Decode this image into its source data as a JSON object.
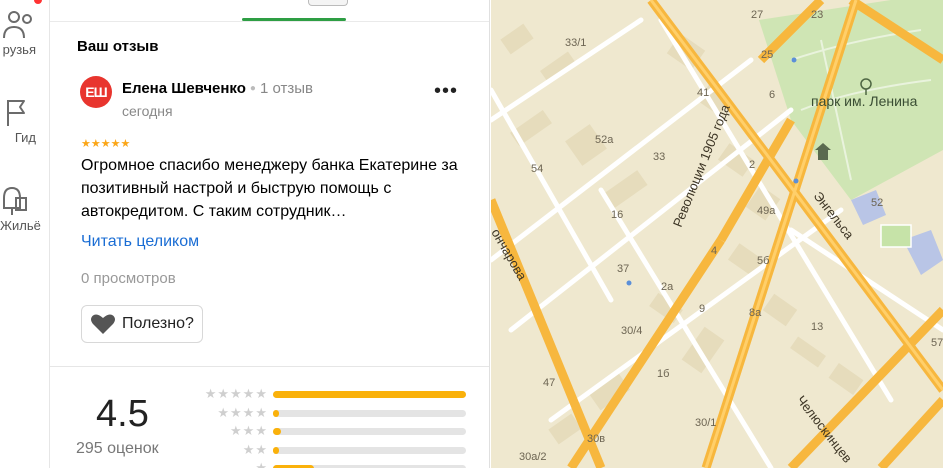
{
  "rail": {
    "items": [
      {
        "label": "рузья",
        "icon": "friends-icon"
      },
      {
        "label": "Гид",
        "icon": "flag-icon"
      },
      {
        "label": "Жильё",
        "icon": "housing-icon"
      }
    ]
  },
  "review": {
    "section_title": "Ваш отзыв",
    "avatar_initials": "ЕШ",
    "author_name": "Елена Шевченко",
    "author_review_count": "1 отзыв",
    "date": "сегодня",
    "stars": 5,
    "text": "Огромное спасибо менеджеру банка Екатерине за позитивный настрой и быструю помощь с автокредитом. С таким сотрудник…",
    "read_more": "Читать целиком",
    "views": "0 просмотров",
    "useful_label": "Полезно?"
  },
  "rating": {
    "average": "4.5",
    "count_label": "295 оценок",
    "distribution": [
      {
        "stars": 5,
        "share": 1.0
      },
      {
        "stars": 4,
        "share": 0.03
      },
      {
        "stars": 3,
        "share": 0.04
      },
      {
        "stars": 2,
        "share": 0.03
      },
      {
        "stars": 1,
        "share": 0.21
      }
    ]
  },
  "colors": {
    "accent_green": "#2e9e44",
    "star_yellow": "#fba617",
    "link_blue": "#1a6dd4",
    "avatar_red": "#e8352e",
    "road_orange": "#f7b73e",
    "park_green": "#cfe5b4"
  },
  "map": {
    "park_label": "парк им. Ленина",
    "streets": [
      "Революции 1905 года",
      "Энгельса",
      "Челюскинцев",
      "онча­рова"
    ],
    "buildings": [
      "33/1",
      "52a",
      "54",
      "33",
      "41",
      "16",
      "37",
      "30/4",
      "47",
      "2a",
      "9",
      "1б",
      "30/1",
      "30в",
      "30a/2",
      "8a",
      "5б",
      "49a",
      "4",
      "13",
      "25",
      "23",
      "27",
      "52",
      "57",
      "6",
      "2"
    ]
  }
}
